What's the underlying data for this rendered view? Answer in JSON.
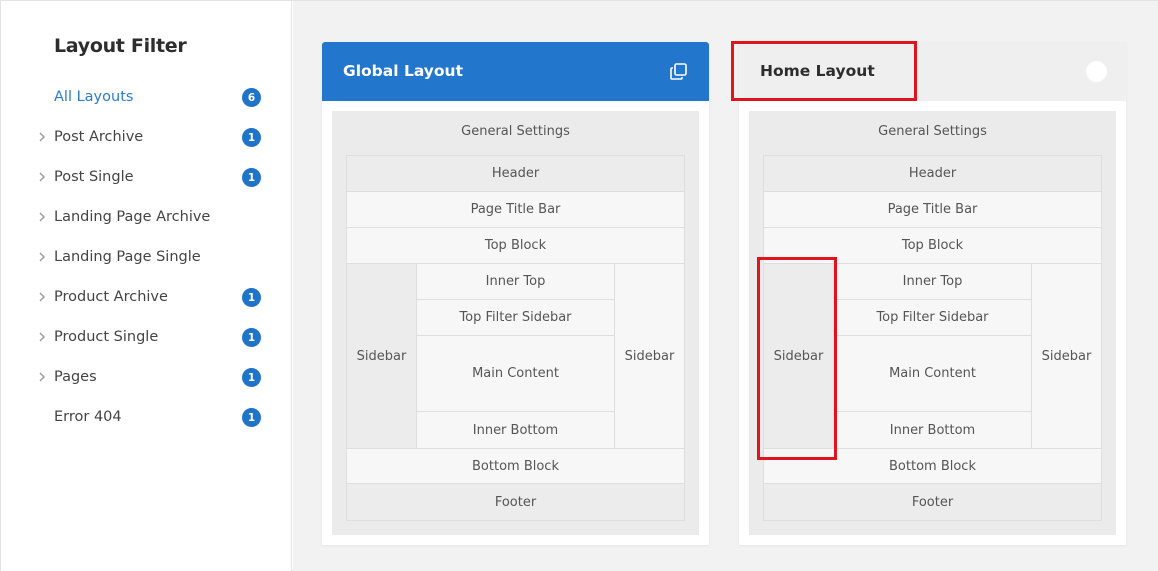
{
  "filter": {
    "title": "Layout Filter",
    "items": [
      {
        "label": "All Layouts",
        "badge": "6",
        "has_chevron": false,
        "active": true
      },
      {
        "label": "Post Archive",
        "badge": "1",
        "has_chevron": true,
        "active": false
      },
      {
        "label": "Post Single",
        "badge": "1",
        "has_chevron": true,
        "active": false
      },
      {
        "label": "Landing Page Archive",
        "badge": "",
        "has_chevron": true,
        "active": false
      },
      {
        "label": "Landing Page Single",
        "badge": "",
        "has_chevron": true,
        "active": false
      },
      {
        "label": "Product Archive",
        "badge": "1",
        "has_chevron": true,
        "active": false
      },
      {
        "label": "Product Single",
        "badge": "1",
        "has_chevron": true,
        "active": false
      },
      {
        "label": "Pages",
        "badge": "1",
        "has_chevron": true,
        "active": false
      },
      {
        "label": "Error 404",
        "badge": "1",
        "has_chevron": false,
        "active": false
      }
    ]
  },
  "cards": {
    "global": {
      "title": "Global Layout",
      "icon": "copy-icon",
      "general": "General Settings",
      "header": "Header",
      "page_title_bar": "Page Title Bar",
      "top_block": "Top Block",
      "sidebar_left": "Sidebar",
      "inner_top": "Inner Top",
      "top_filter_sidebar": "Top Filter Sidebar",
      "main_content": "Main Content",
      "inner_bottom": "Inner Bottom",
      "sidebar_right": "Sidebar",
      "bottom_block": "Bottom Block",
      "footer": "Footer"
    },
    "home": {
      "title": "Home Layout",
      "icon": "toggle-icon",
      "general": "General Settings",
      "header": "Header",
      "page_title_bar": "Page Title Bar",
      "top_block": "Top Block",
      "sidebar_left": "Sidebar",
      "inner_top": "Inner Top",
      "top_filter_sidebar": "Top Filter Sidebar",
      "main_content": "Main Content",
      "inner_bottom": "Inner Bottom",
      "sidebar_right": "Sidebar",
      "bottom_block": "Bottom Block",
      "footer": "Footer"
    }
  },
  "colors": {
    "accent": "#2276cc",
    "badge": "#1f73c9",
    "highlight": "#e0141e"
  }
}
